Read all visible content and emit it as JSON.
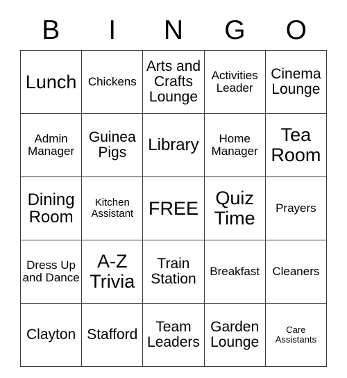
{
  "card": {
    "headers": [
      "B",
      "I",
      "N",
      "G",
      "O"
    ],
    "rows": [
      [
        {
          "text": "Lunch",
          "size": "xxl"
        },
        {
          "text": "Chickens",
          "size": "m"
        },
        {
          "text": "Arts and Crafts Lounge",
          "size": "l"
        },
        {
          "text": "Activities Leader",
          "size": "m"
        },
        {
          "text": "Cinema Lounge",
          "size": "l"
        }
      ],
      [
        {
          "text": "Admin Manager",
          "size": "m"
        },
        {
          "text": "Guinea Pigs",
          "size": "l"
        },
        {
          "text": "Library",
          "size": "xl"
        },
        {
          "text": "Home Manager",
          "size": "m"
        },
        {
          "text": "Tea Room",
          "size": "xxl"
        }
      ],
      [
        {
          "text": "Dining Room",
          "size": "xl"
        },
        {
          "text": "Kitchen Assistant",
          "size": "s"
        },
        {
          "text": "FREE",
          "size": "xxl"
        },
        {
          "text": "Quiz Time",
          "size": "xxl"
        },
        {
          "text": "Prayers",
          "size": "m"
        }
      ],
      [
        {
          "text": "Dress Up and Dance",
          "size": "m"
        },
        {
          "text": "A-Z Trivia",
          "size": "xxl"
        },
        {
          "text": "Train Station",
          "size": "l"
        },
        {
          "text": "Breakfast",
          "size": "m"
        },
        {
          "text": "Cleaners",
          "size": "m"
        }
      ],
      [
        {
          "text": "Clayton",
          "size": "l"
        },
        {
          "text": "Stafford",
          "size": "l"
        },
        {
          "text": "Team Leaders",
          "size": "l"
        },
        {
          "text": "Garden Lounge",
          "size": "l"
        },
        {
          "text": "Care Assistants",
          "size": "xs"
        }
      ]
    ]
  }
}
